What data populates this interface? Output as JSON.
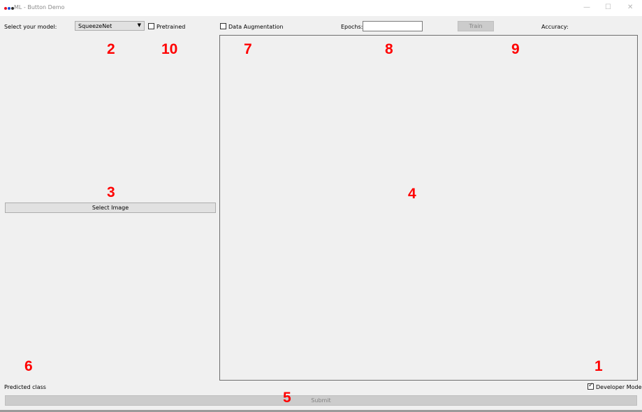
{
  "window": {
    "title": "ML - Button Demo",
    "minimize_glyph": "—",
    "maximize_glyph": "☐",
    "close_glyph": "✕",
    "icon_colors": [
      "#e81123",
      "#1a4fd8",
      "#2d2d2d"
    ]
  },
  "toolbar": {
    "model_label": "Select your model:",
    "model_value": "SqueezeNet",
    "pretrained_label": "Pretrained",
    "pretrained_checked": false,
    "augmentation_label": "Data Augmentation",
    "augmentation_checked": false,
    "epochs_label": "Epochs:",
    "epochs_value": "",
    "train_label": "Train",
    "accuracy_label": "Accuracy:"
  },
  "left_panel": {
    "select_image_label": "Select Image",
    "predicted_class_label": "Predicted class"
  },
  "bottom": {
    "developer_mode_label": "Developer Mode",
    "developer_mode_checked": true,
    "submit_label": "Submit"
  },
  "annotations": {
    "n1": "1",
    "n2": "2",
    "n3": "3",
    "n4": "4",
    "n5": "5",
    "n6": "6",
    "n7": "7",
    "n8": "8",
    "n9": "9",
    "n10": "10"
  }
}
